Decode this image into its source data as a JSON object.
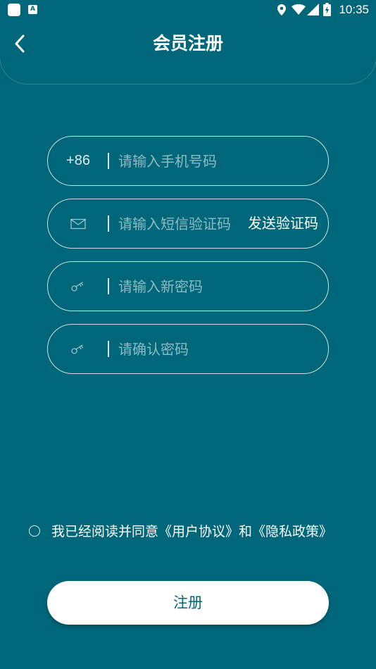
{
  "status_bar": {
    "a_icon_letter": "A",
    "time": "10:35"
  },
  "header": {
    "title": "会员注册"
  },
  "form": {
    "phone": {
      "prefix": "+86",
      "placeholder": "请输入手机号码",
      "value": ""
    },
    "sms_code": {
      "icon": "envelope-icon",
      "placeholder": "请输入短信验证码",
      "value": "",
      "send_label": "发送验证码"
    },
    "new_password": {
      "icon": "key-icon",
      "placeholder": "请输入新密码",
      "value": ""
    },
    "confirm_password": {
      "icon": "key-icon",
      "placeholder": "请确认密码",
      "value": ""
    }
  },
  "agreement": {
    "checked": false,
    "prefix": "我已经阅读并同意",
    "user_agreement": "《用户协议》",
    "conjunction": "和",
    "privacy_policy": "《隐私政策》"
  },
  "actions": {
    "register_label": "注册"
  },
  "colors": {
    "background": "#00667a",
    "button_background": "#ffffff",
    "button_text": "#00667a"
  }
}
